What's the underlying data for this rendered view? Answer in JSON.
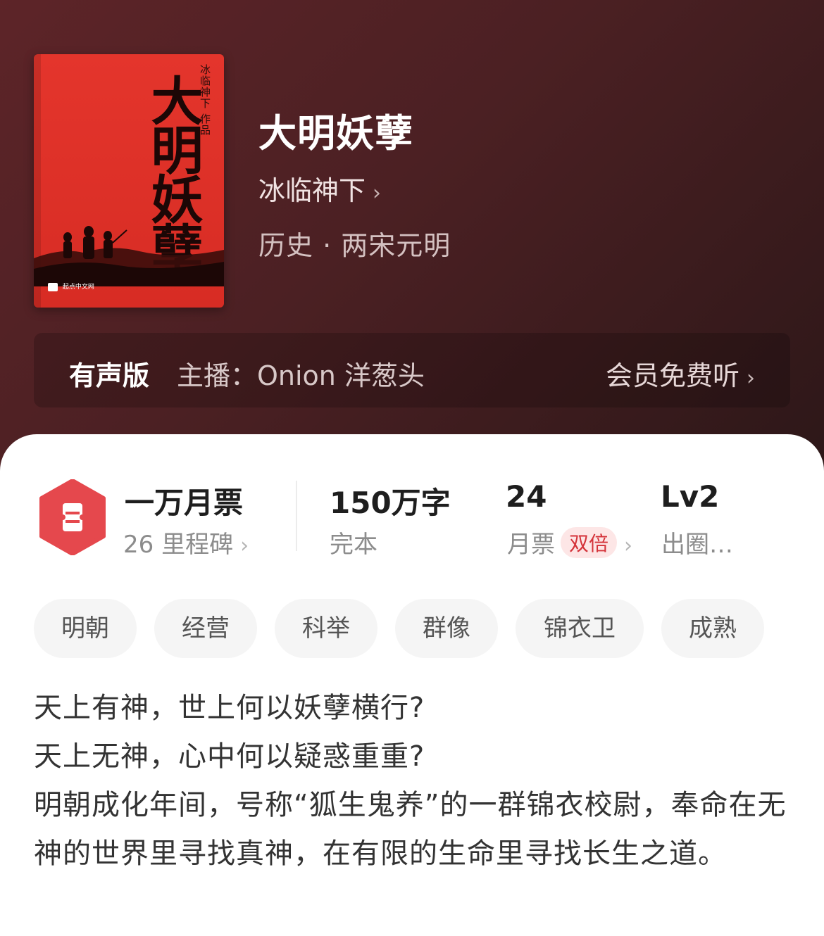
{
  "book": {
    "title": "大明妖孽",
    "author": "冰临神下",
    "author_chevron": "›",
    "genre": "历史 · 两宋元明",
    "cover": {
      "title_text": "大明妖孽",
      "author_text": "冰临神下 作品",
      "publisher": "起点中文网",
      "color": "#e4352c"
    }
  },
  "audio": {
    "label": "有声版",
    "host": "主播：Onion 洋葱头",
    "cta": "会员免费听",
    "chevron": "›"
  },
  "stats": {
    "ticket": {
      "icon": "ticket-icon",
      "title": "一万月票",
      "sub": "26 里程碑",
      "chevron": "›"
    },
    "words": {
      "value": "150万字",
      "sub": "完本"
    },
    "monthly": {
      "value": "24",
      "sub": "月票",
      "badge": "双倍",
      "chevron": "›"
    },
    "level": {
      "value": "Lv2",
      "sub": "出圈…"
    }
  },
  "tags": [
    "明朝",
    "经营",
    "科举",
    "群像",
    "锦衣卫",
    "成熟"
  ],
  "description": [
    "天上有神，世上何以妖孽横行?",
    "天上无神，心中何以疑惑重重?",
    "明朝成化年间，号称“狐生鬼养”的一群锦衣校尉，奉命在无神的世界里寻找真神，在有限的生命里寻找长生之道。"
  ],
  "colors": {
    "hero_bg": "#4b2023",
    "accent_red": "#e5484d",
    "badge_bg": "#fde6e6",
    "badge_text": "#d4333a"
  }
}
